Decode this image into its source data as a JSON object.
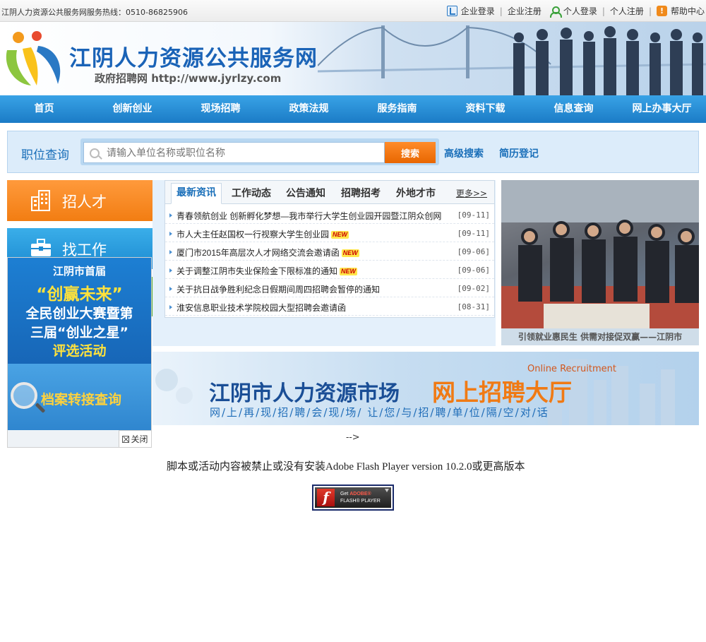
{
  "topbar": {
    "hotline": "江阴人力资源公共服务网服务热线：0510-86825906",
    "links": {
      "ent_login": "企业登录",
      "ent_register": "企业注册",
      "person_login": "个人登录",
      "person_register": "个人注册",
      "help": "帮助中心"
    },
    "separator": "|"
  },
  "header": {
    "title": "江阴人力资源公共服务网",
    "subtitle": "政府招聘网 http://www.jyrlzy.com"
  },
  "nav": {
    "items": [
      "首页",
      "创新创业",
      "现场招聘",
      "政策法规",
      "服务指南",
      "资料下载",
      "信息查询",
      "网上办事大厅"
    ]
  },
  "search": {
    "label": "职位查询",
    "placeholder": "请输入单位名称或职位名称",
    "button": "搜索",
    "advanced": "高级搜索",
    "resume": "简历登记"
  },
  "side": {
    "recruit_talent": "招人才",
    "find_job": "找工作"
  },
  "float_ad": {
    "line1": "江阴市首届",
    "line2": "“创赢未来”",
    "line3": "全民创业大赛暨第",
    "line4": "三届“创业之星”",
    "line5": "评选活动",
    "archive": "档案转接查询",
    "close": "关闭"
  },
  "news": {
    "tabs": [
      "最新资讯",
      "工作动态",
      "公告通知",
      "招聘招考",
      "外地才市"
    ],
    "more": "更多>>",
    "new_badge": "NEW",
    "items": [
      {
        "title": "青春领航创业 创新孵化梦想—我市举行大学生创业园开园暨江阴众创网",
        "date": "[09-11]",
        "is_new": false
      },
      {
        "title": "市人大主任赵国权一行视察大学生创业园",
        "date": "[09-11]",
        "is_new": true
      },
      {
        "title": "厦门市2015年高层次人才网络交流会邀请函",
        "date": "[09-06]",
        "is_new": true
      },
      {
        "title": "关于调整江阴市失业保险金下限标准的通知",
        "date": "[09-06]",
        "is_new": true
      },
      {
        "title": "关于抗日战争胜利纪念日假期间周四招聘会暂停的通知",
        "date": "[09-02]",
        "is_new": false
      },
      {
        "title": "淮安信息职业技术学院校园大型招聘会邀请函",
        "date": "[08-31]",
        "is_new": false
      }
    ]
  },
  "photo": {
    "caption": "引领就业惠民生 供需对接促双赢——江阴市"
  },
  "recruit_banner": {
    "en": "Online Recruitment",
    "cn1": "江阴市人力资源市场",
    "cn2": "网上招聘大厅",
    "slogan": "网/上/再/现/招/聘/会/现/场/ 让/您/与/招/聘/单/位/隔/空/对/话"
  },
  "flash": {
    "arrow": "-->",
    "message": "脚本或活动内容被禁止或没有安装Adobe Flash Player version 10.2.0或更高版本",
    "btn_line1_prefix": "Get ",
    "btn_line1_brand": "ADOBE®",
    "btn_line2": "FLASH® PLAYER"
  },
  "colors": {
    "nav_blue": "#1b7bc6",
    "title_blue": "#1a63b7",
    "search_orange": "#f27d12",
    "link_blue": "#1a6fb9"
  }
}
